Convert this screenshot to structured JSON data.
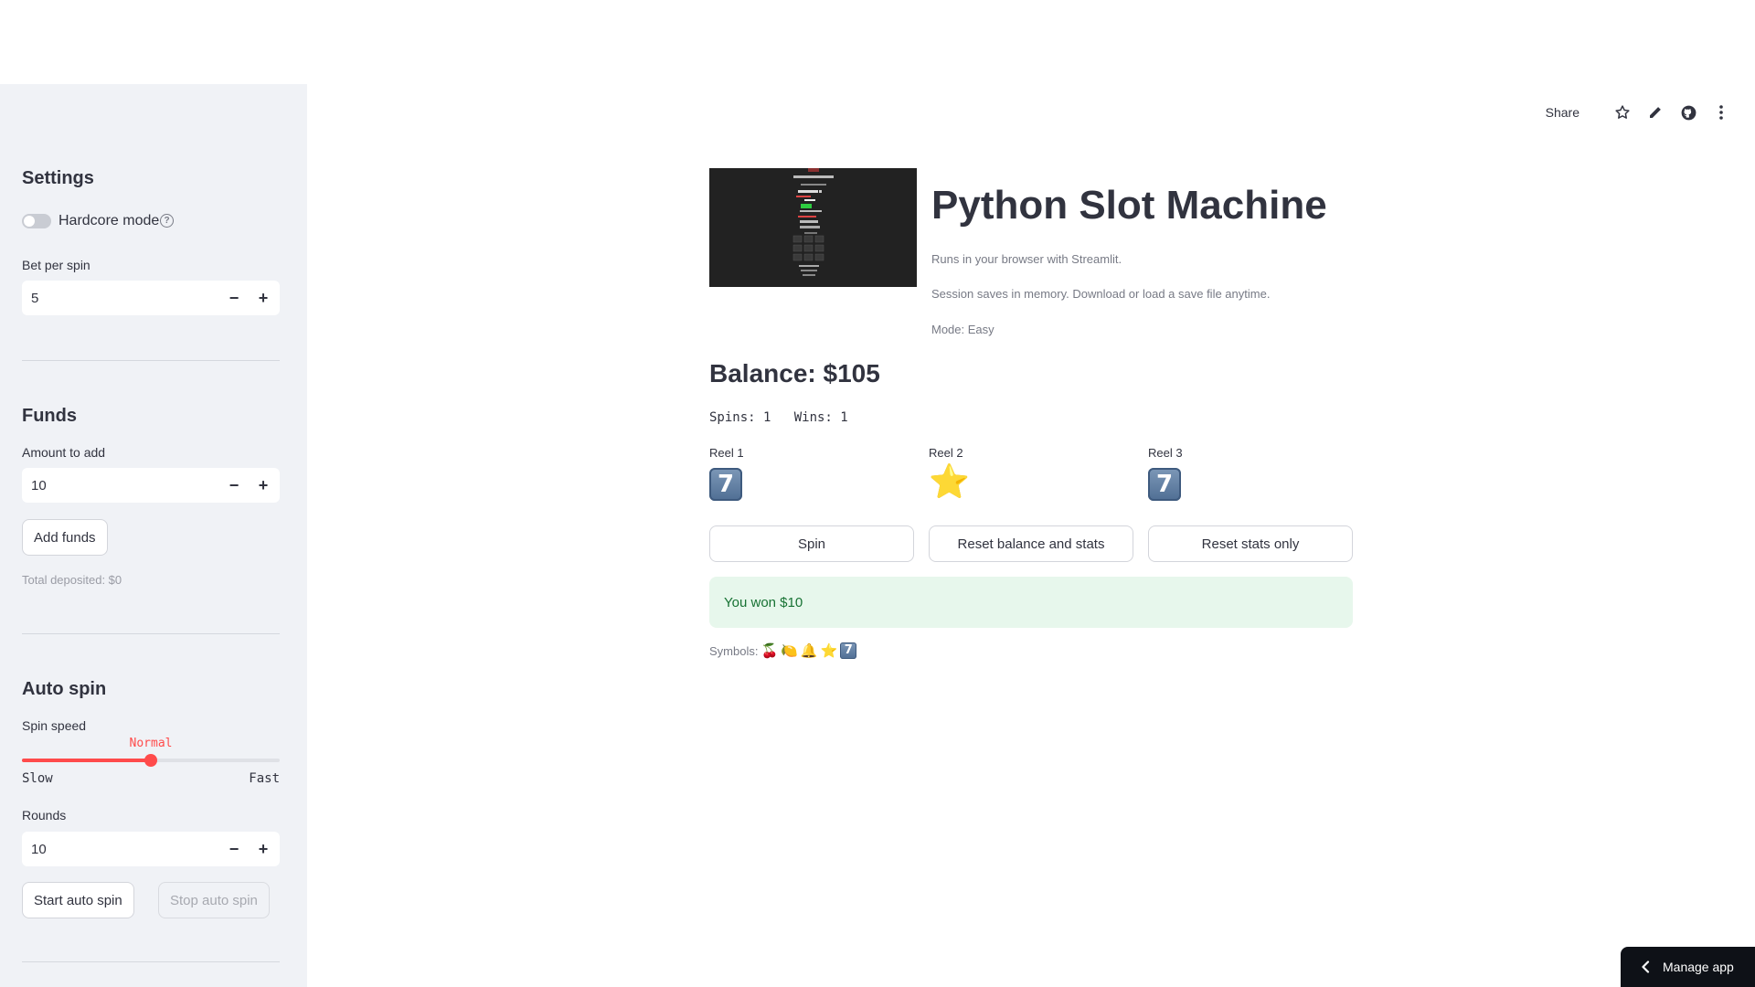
{
  "sidebar": {
    "settings_heading": "Settings",
    "hardcore_label": "Hardcore mode",
    "hardcore_enabled": false,
    "bet_label": "Bet per spin",
    "bet_value": "5",
    "funds_heading": "Funds",
    "amount_label": "Amount to add",
    "amount_value": "10",
    "add_funds_label": "Add funds",
    "total_deposited": "Total deposited: $0",
    "autospin_heading": "Auto spin",
    "speed_label": "Spin speed",
    "speed_value": "Normal",
    "speed_level": 0.5,
    "speed_min": "Slow",
    "speed_max": "Fast",
    "rounds_label": "Rounds",
    "rounds_value": "10",
    "start_label": "Start auto spin",
    "stop_label": "Stop auto spin",
    "minus": "−",
    "plus": "+"
  },
  "toolbar": {
    "share_label": "Share"
  },
  "main": {
    "title": "Python Slot Machine",
    "caption1": "Runs in your browser with Streamlit.",
    "caption2": "Session saves in memory. Download or load a save file anytime.",
    "mode": "Mode: Easy",
    "balance": "Balance: $105",
    "stats": "Spins: 1   Wins: 1",
    "reels": [
      {
        "label": "Reel 1",
        "symbol": "7"
      },
      {
        "label": "Reel 2",
        "symbol": "⭐"
      },
      {
        "label": "Reel 3",
        "symbol": "7"
      }
    ],
    "spin_label": "Spin",
    "reset_all_label": "Reset balance and stats",
    "reset_stats_label": "Reset stats only",
    "result": "You won $10",
    "symbols_label": "Symbols:",
    "symbols": [
      "🍒",
      "🍋",
      "🔔",
      "⭐",
      "7"
    ]
  },
  "manage_app_label": "Manage app",
  "colors": {
    "sidebar_bg": "#f0f2f6",
    "accent": "#ff4b4b",
    "success_bg": "#e7f7ec",
    "success_text": "#177233"
  }
}
